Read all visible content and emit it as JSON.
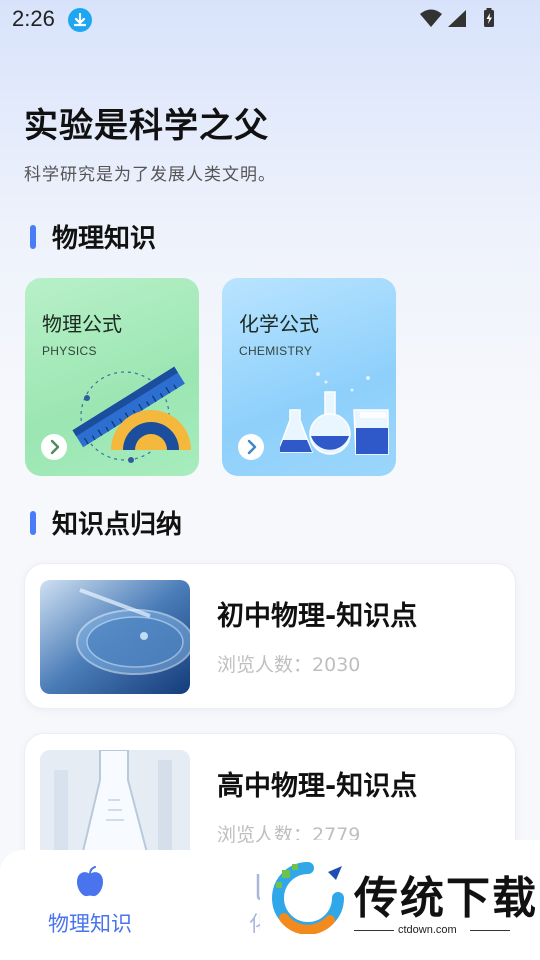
{
  "status_bar": {
    "time": "2:26"
  },
  "hero": {
    "title": "实验是科学之父",
    "subtitle": "科学研究是为了发展人类文明。"
  },
  "sections": {
    "physics_knowledge": "物理知识",
    "summary": "知识点归纳"
  },
  "category_cards": [
    {
      "title": "物理公式",
      "subtitle_en": "PHYSICS",
      "icon": "ruler-protractor-illustration",
      "color": "#9be6b2"
    },
    {
      "title": "化学公式",
      "subtitle_en": "CHEMISTRY",
      "icon": "flasks-illustration",
      "color": "#8ed0fb"
    }
  ],
  "knowledge_items": [
    {
      "title": "初中物理-知识点",
      "views_label": "浏览人数：",
      "views": "2030",
      "thumb": "petri-dish-image"
    },
    {
      "title": "高中物理-知识点",
      "views_label": "浏览人数：",
      "views": "2779",
      "thumb": "glass-flask-image"
    }
  ],
  "bottom_nav": [
    {
      "label": "物理知识",
      "icon": "apple-icon",
      "active": true
    },
    {
      "label": "化学",
      "icon": "beaker-icon",
      "active": false
    }
  ],
  "watermark": {
    "text": "传统下载",
    "url": "ctdown.com"
  },
  "colors": {
    "accent": "#4a74ee",
    "section_bar": "#4a7cf7"
  }
}
